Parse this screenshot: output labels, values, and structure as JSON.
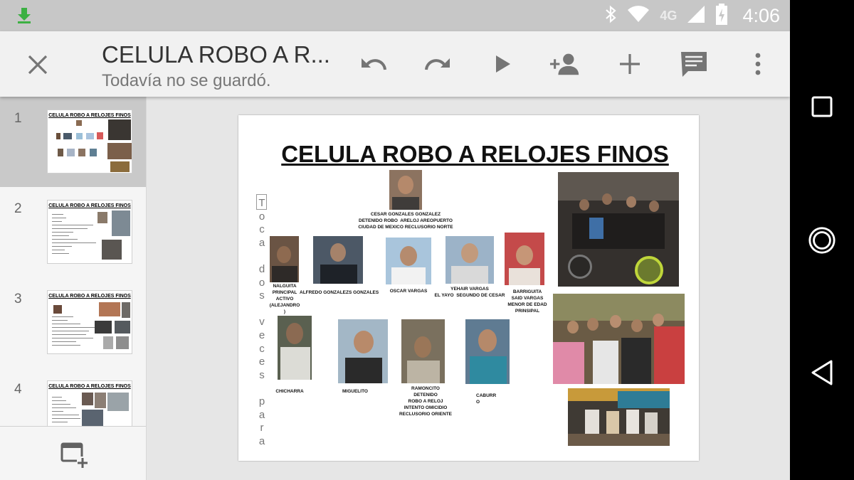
{
  "status_bar": {
    "network": "4G",
    "time": "4:06",
    "icons": [
      "download-icon",
      "bluetooth-icon",
      "wifi-icon",
      "cell-signal-icon",
      "battery-icon"
    ]
  },
  "toolbar": {
    "title": "CELULA ROBO A R...",
    "subtitle": "Todavía no se guardó.",
    "icons": [
      "close-icon",
      "undo-icon",
      "redo-icon",
      "present-icon",
      "add-person-icon",
      "add-icon",
      "comment-icon",
      "more-vert-icon"
    ]
  },
  "slides_panel": {
    "thumbnails": [
      {
        "number": "1",
        "title": "CELULA ROBO A RELOJES FINOS",
        "selected": true
      },
      {
        "number": "2",
        "title": "CELULA ROBO A RELOJES FINOS",
        "selected": false
      },
      {
        "number": "3",
        "title": "CELULA ROBO A RELOJES FINOS",
        "selected": false
      },
      {
        "number": "4",
        "title": "CELULA ROBO A RELOJES FINOS",
        "selected": false
      }
    ],
    "add_slide_icon": "add-slide-icon"
  },
  "slide": {
    "title": "CELULA ROBO A RELOJES FINOS",
    "placeholder_text": "T\no\nc\na\n \nd\no\ns\n \nv\ne\nc\ne\ns\n \np\na\nr\na\n \na\nñ\na",
    "captions": {
      "leader": "CESAR GONZALES GONZALEZ\nDETENIDO ROBO  ARELOJ AREOPUERTO\nCIUDAD DE MEXICO RECLUSORIO NORTE",
      "nalguita": "NALGUITA\nPRINCIPAL\nACTIVO\n(ALEJANDRO\n)",
      "alfredo": "ALFREDO GONZALEZS GONZALES",
      "oscar": "OSCAR VARGAS",
      "yehair": "YEHAIR VARGAS\nEL YAYO  SEGUNDO DE CESAR",
      "barriguita": "BARRIGUITA\nSAID VARGAS\nMENOR DE EDAD\nPRINSIPAL",
      "chicharra": "CHICHARRA",
      "miguelito": "MIGUELITO",
      "ramoncito": "RAMONCITO\nDETENIDO\nROBO A RELOJ\nINTENTO OMICIDIO\nRECLUSORIO ORIENTE",
      "caburro": "CABURR\nO"
    }
  },
  "nav_bar": {
    "icons": [
      "recents-icon",
      "home-icon",
      "back-icon"
    ]
  },
  "colors": {
    "status_bar": "#c7c7c7",
    "toolbar": "#f1f1f1",
    "icon_gray": "#757575",
    "canvas": "#e6e6e6",
    "selected_thumb": "#c9c9c9"
  }
}
